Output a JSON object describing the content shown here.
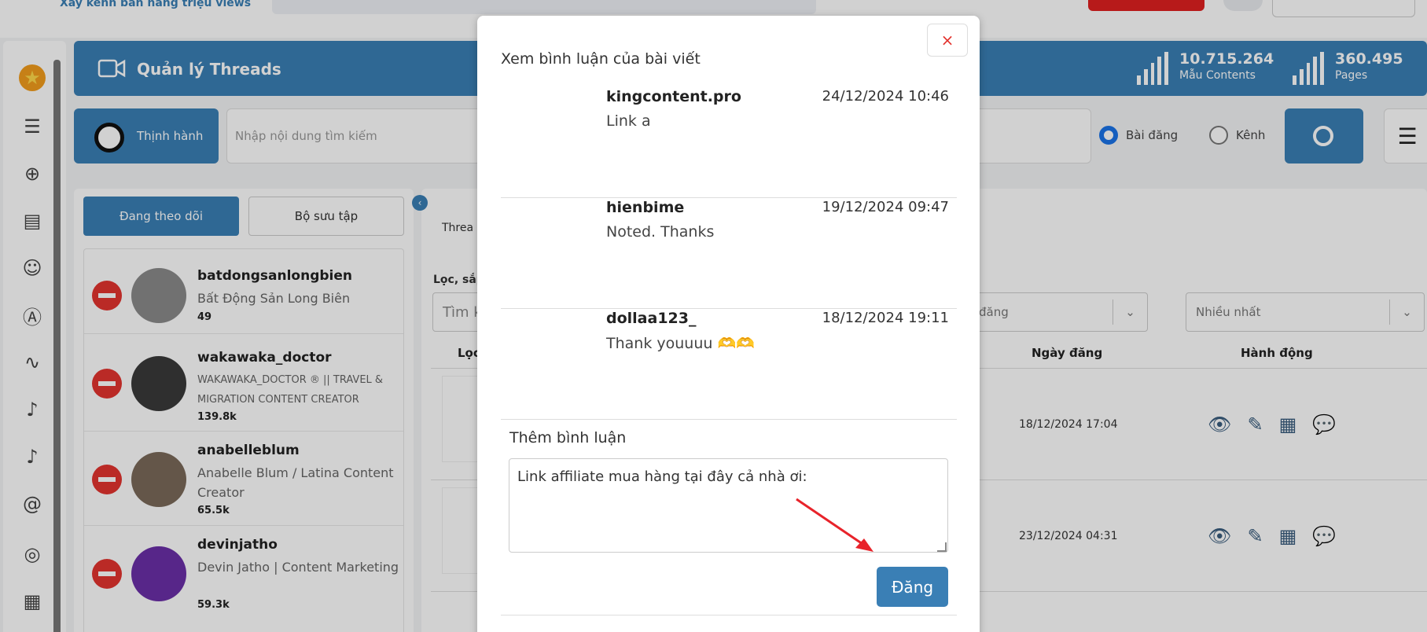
{
  "brand": {
    "tagline": "Xây kênh bán hàng triệu views"
  },
  "header": {
    "title": "Quản lý Threads",
    "stats": [
      {
        "value": "10.715.264",
        "label": "Mẫu Contents"
      },
      {
        "value": "360.495",
        "label": "Pages"
      }
    ]
  },
  "search": {
    "trend_label": "Thịnh hành",
    "placeholder": "Nhập nội dung tìm kiếm",
    "radio_post": "Bài đăng",
    "radio_channel": "Kênh",
    "selected": "Bài đăng"
  },
  "left_panel": {
    "tab_following": "Đang theo dõi",
    "tab_collection": "Bộ sưu tập",
    "accounts": [
      {
        "name": "batdongsanlongbien",
        "desc": "Bất Động Sản Long Biên",
        "count": "49"
      },
      {
        "name": "wakawaka_doctor",
        "desc": "WAKAWAKA_DOCTOR ® || TRAVEL & MIGRATION CONTENT CREATOR",
        "count": "139.8k"
      },
      {
        "name": "anabelleblum",
        "desc": "Anabelle Blum / Latina Content Creator",
        "count": "65.5k"
      },
      {
        "name": "devinjatho",
        "desc": "Devin Jatho | Content Marketing",
        "count": "59.3k"
      }
    ]
  },
  "right_panel": {
    "tab_partial": "Threa",
    "filter_label_partial": "Lọc, sắp",
    "search_partial": "Tìm k",
    "col_loc_partial": "Lọc",
    "select_1_partial": "đăng",
    "select_2": "Nhiều nhất",
    "col_date": "Ngày đăng",
    "col_action": "Hành động",
    "rows": [
      {
        "date": "18/12/2024 17:04"
      },
      {
        "date": "23/12/2024 04:31"
      }
    ]
  },
  "modal": {
    "close_symbol": "×",
    "title": "Xem bình luận của bài viết",
    "comments": [
      {
        "author": "kingcontent.pro",
        "time": "24/12/2024 10:46",
        "text": "Link a"
      },
      {
        "author": "hienbime",
        "time": "19/12/2024 09:47",
        "text": "Noted. Thanks"
      },
      {
        "author": "dollaa123_",
        "time": "18/12/2024 19:11",
        "text": "Thank youuuu 🫶🫶"
      }
    ],
    "add_label": "Thêm bình luận",
    "input_value": "Link affiliate mua hàng tại đây cả nhà ơi: ",
    "post_label": "Đăng"
  },
  "colors": {
    "primary": "#3a7fb5",
    "danger": "#e3342f",
    "annotation_arrow": "#e8232a"
  },
  "icons": [
    "star-icon",
    "list-icon",
    "plus-icon",
    "document-icon",
    "smile-icon",
    "ad-icon",
    "chart-icon",
    "tiktok-icon",
    "threads-icon",
    "camera-icon",
    "grid-icon",
    "video-camera-icon",
    "search-icon",
    "sliders-icon",
    "eye-icon",
    "pencil-icon",
    "calendar-icon",
    "comments-icon",
    "close-icon",
    "chevron-left-icon",
    "chevron-down-icon"
  ]
}
